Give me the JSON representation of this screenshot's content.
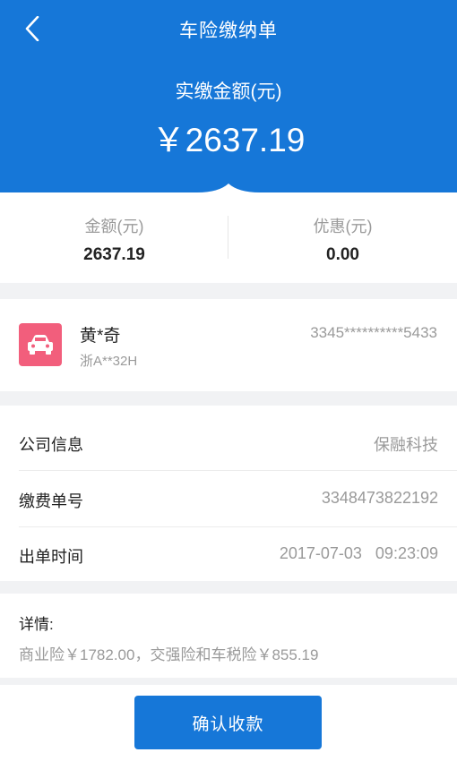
{
  "header": {
    "title": "车险缴纳单",
    "back_icon": "chevron-left-icon",
    "paid_label": "实缴金额(元)",
    "paid_amount": "￥2637.19"
  },
  "summary": {
    "amount_label": "金额(元)",
    "amount_value": "2637.19",
    "discount_label": "优惠(元)",
    "discount_value": "0.00"
  },
  "person": {
    "icon": "car-icon",
    "name": "黄*奇",
    "plate": "浙A**32H",
    "id_number": "3345**********5433"
  },
  "info": {
    "company_label": "公司信息",
    "company_value": "保融科技",
    "order_label": "缴费单号",
    "order_value": "3348473822192",
    "time_label": "出单时间",
    "time_value": "2017-07-03   09:23:09"
  },
  "details": {
    "title": "详情:",
    "text": "商业险￥1782.00，交强险和车税险￥855.19"
  },
  "actions": {
    "confirm_label": "确认收款"
  },
  "colors": {
    "primary": "#1677d8",
    "car_icon_bg": "#f25e7c",
    "background": "#f1f2f4"
  }
}
